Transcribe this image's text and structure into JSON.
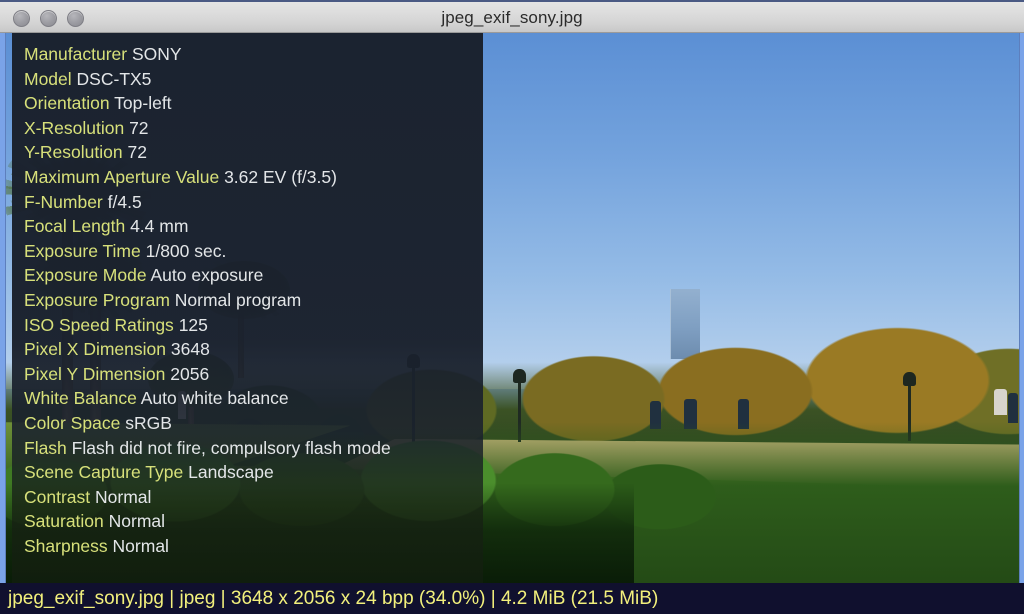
{
  "window": {
    "title": "jpeg_exif_sony.jpg",
    "controls": [
      {
        "name": "close-button",
        "color": "#9b9ba1"
      },
      {
        "name": "minimize-button",
        "color": "#9b9ba1"
      },
      {
        "name": "maximize-button",
        "color": "#9b9ba1"
      }
    ]
  },
  "exif": {
    "rows": [
      {
        "key": "Manufacturer",
        "value": "SONY"
      },
      {
        "key": "Model",
        "value": "DSC-TX5"
      },
      {
        "key": "Orientation",
        "value": "Top-left"
      },
      {
        "key": "X-Resolution",
        "value": "72"
      },
      {
        "key": "Y-Resolution",
        "value": "72"
      },
      {
        "key": "Maximum Aperture Value",
        "value": "3.62 EV (f/3.5)"
      },
      {
        "key": "F-Number",
        "value": "f/4.5"
      },
      {
        "key": "Focal Length",
        "value": "4.4 mm"
      },
      {
        "key": "Exposure Time",
        "value": "1/800 sec."
      },
      {
        "key": "Exposure Mode",
        "value": "Auto exposure"
      },
      {
        "key": "Exposure Program",
        "value": "Normal program"
      },
      {
        "key": "ISO Speed Ratings",
        "value": "125"
      },
      {
        "key": "Pixel X Dimension",
        "value": "3648"
      },
      {
        "key": "Pixel Y Dimension",
        "value": "2056"
      },
      {
        "key": "White Balance",
        "value": "Auto white balance"
      },
      {
        "key": "Color Space",
        "value": "sRGB"
      },
      {
        "key": "Flash",
        "value": "Flash did not fire, compulsory flash mode"
      },
      {
        "key": "Scene Capture Type",
        "value": "Landscape"
      },
      {
        "key": "Contrast",
        "value": "Normal"
      },
      {
        "key": "Saturation",
        "value": "Normal"
      },
      {
        "key": "Sharpness",
        "value": "Normal"
      }
    ],
    "key_color": "#d7e07a",
    "value_color": "#e3e6e8"
  },
  "statusbar": {
    "text": "jpeg_exif_sony.jpg | jpeg | 3648 x 2056 x 24 bpp (34.0%) | 4.2 MiB (21.5 MiB)",
    "filename": "jpeg_exif_sony.jpg",
    "format": "jpeg",
    "dimensions": "3648 x 2056 x 24 bpp",
    "zoom": "34.0%",
    "file_size": "4.2 MiB",
    "memory_size": "21.5 MiB",
    "background": "#10102e",
    "text_color": "#f2f07c"
  },
  "photo": {
    "description": "Park scene with palm trees, path and autumn foliage",
    "sky_color": "#74a3dd",
    "lawn_color": "#79993c",
    "path_color": "#c8b178"
  }
}
